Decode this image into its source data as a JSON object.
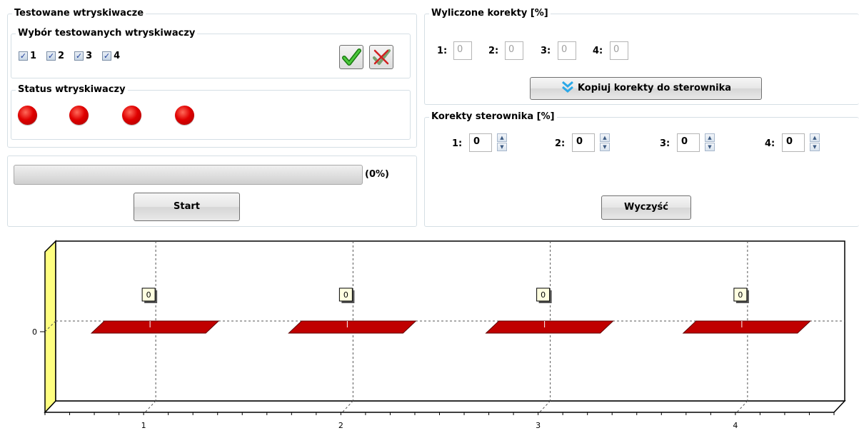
{
  "injectors_panel": {
    "title": "Testowane wtryskiwacze",
    "selection": {
      "title": "Wybór testowanych wtryskiwaczy",
      "checkboxes": [
        {
          "label": "1",
          "checked": true
        },
        {
          "label": "2",
          "checked": true
        },
        {
          "label": "3",
          "checked": true
        },
        {
          "label": "4",
          "checked": true
        }
      ],
      "select_all_icon": "green-check-icon",
      "deselect_all_icon": "crossed-check-icon"
    },
    "status": {
      "title": "Status wtryskiwaczy",
      "leds": [
        "red",
        "red",
        "red",
        "red"
      ],
      "led_color": "#e00000"
    }
  },
  "progress": {
    "value": 0,
    "text": "(0%)"
  },
  "start_button": "Start",
  "calculated": {
    "title": "Wyliczone korekty [%]",
    "items": [
      {
        "label": "1:",
        "value": "0"
      },
      {
        "label": "2:",
        "value": "0"
      },
      {
        "label": "3:",
        "value": "0"
      },
      {
        "label": "4:",
        "value": "0"
      }
    ],
    "copy_button": "Kopiuj korekty do sterownika",
    "copy_icon": "double-chevron-down-icon"
  },
  "controller": {
    "title": "Korekty sterownika [%]",
    "items": [
      {
        "label": "1:",
        "value": "0"
      },
      {
        "label": "2:",
        "value": "0"
      },
      {
        "label": "3:",
        "value": "0"
      },
      {
        "label": "4:",
        "value": "0"
      }
    ],
    "clear_button": "Wyczyść"
  },
  "chart_data": {
    "type": "bar",
    "categories": [
      "1",
      "2",
      "3",
      "4"
    ],
    "values": [
      0,
      0,
      0,
      0
    ],
    "data_labels": [
      "0",
      "0",
      "0",
      "0"
    ],
    "y_ticks": [
      "0"
    ],
    "ylim": [
      -1,
      1
    ],
    "grid": true,
    "bar_color": "#c00000",
    "wall_color": "#ffff80",
    "title": "",
    "xlabel": "",
    "ylabel": ""
  }
}
